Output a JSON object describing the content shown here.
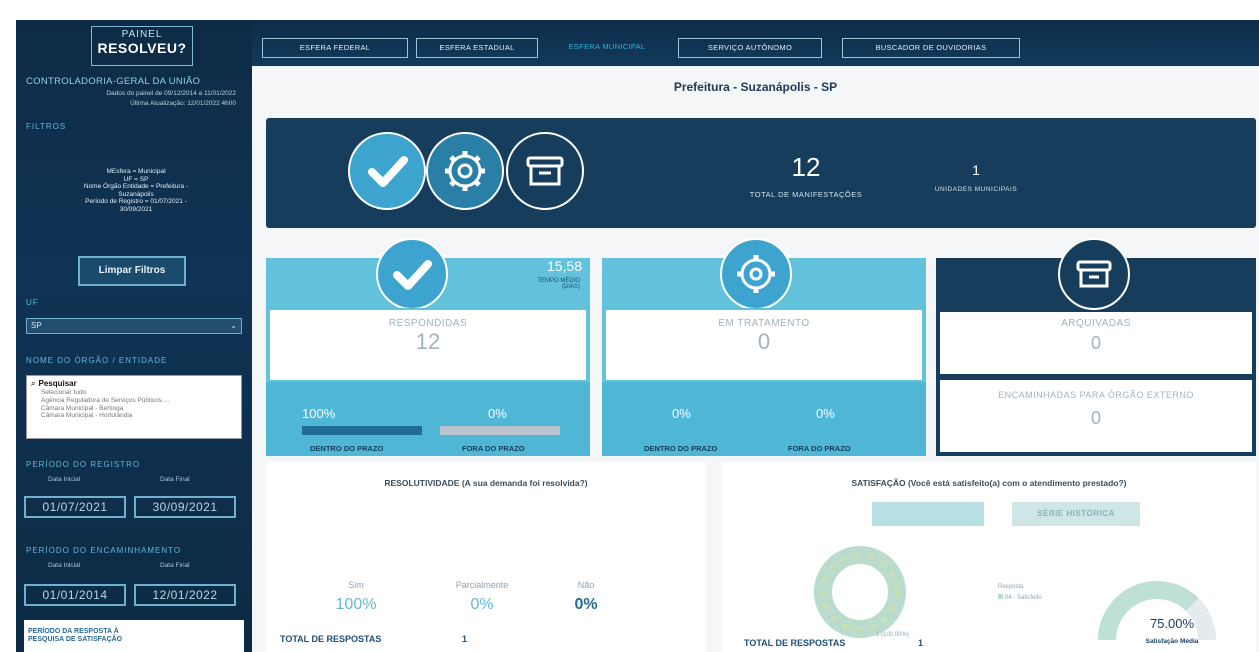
{
  "sidebar": {
    "logo_line1": "PAINEL",
    "logo_line2": "RESOLVEU?",
    "org": "CONTROLADORIA-GERAL DA UNIÃO",
    "data_range": "Dados do painel de 09/12/2014 a 11/01/2022",
    "last_update": "Última Atualização: 12/01/2022 4h00",
    "filters_title": "FILTROS",
    "filters": [
      "MEsfera = Municipal",
      "UF = SP",
      "Nome Órgão Entidade = Prefeitura -",
      "Suzanápolis",
      "Período de Registro = 01/07/2021 -",
      "30/09/2021"
    ],
    "clear_button": "Limpar Filtros",
    "uf_label": "UF",
    "uf_value": "SP",
    "org_label": "NOME DO ÓRGÃO / ENTIDADE",
    "org_search": "Pesquisar",
    "org_items": [
      "Selecionar tudo",
      "Agência Reguladora de Serviços Públicos ...",
      "Câmara Municipal - Bertioga",
      "Câmara Municipal - Hortolândia"
    ],
    "registro_label": "PERÍODO DO REGISTRO",
    "registro_initial_label": "Data Inicial",
    "registro_final_label": "Data Final",
    "registro_initial": "01/07/2021",
    "registro_final": "30/09/2021",
    "encaminhamento_label": "PERÍODO DO ENCAMINHAMENTO",
    "enc_initial_label": "Data Inicial",
    "enc_final_label": "Data Final",
    "enc_initial": "01/01/2014",
    "enc_final": "12/01/2022",
    "resposta_line1": "PERÍODO DA RESPOSTA À",
    "resposta_line2": "PESQUISA DE SATISFAÇÃO"
  },
  "tabs": [
    {
      "label": "ESFERA FEDERAL"
    },
    {
      "label": "ESFERA ESTADUAL"
    },
    {
      "label": "ESFERA MUNICIPAL"
    },
    {
      "label": "SERVIÇO AUTÔNOMO"
    },
    {
      "label": "BUSCADOR DE OUVIDORIAS"
    }
  ],
  "title": "Prefeitura - Suzanápolis - SP",
  "summary": {
    "total_value": "12",
    "total_label": "TOTAL DE MANIFESTAÇÕES",
    "units_value": "1",
    "units_label": "UNIDADES MUNICIPAIS"
  },
  "respondidas": {
    "avg_time": "15,58",
    "avg_time_label1": "TEMPO MÉDIO",
    "avg_time_label2": "(DIAS)",
    "label": "RESPONDIDAS",
    "value": "12",
    "in_time_pct": "100%",
    "out_time_pct": "0%",
    "in_time_fraction": 1.0,
    "in_time_label": "DENTRO DO PRAZO",
    "out_time_label": "FORA DO PRAZO"
  },
  "tratamento": {
    "label": "EM TRATAMENTO",
    "value": "0",
    "in_time_pct": "0%",
    "out_time_pct": "0%",
    "in_time_label": "DENTRO DO PRAZO",
    "out_time_label": "FORA DO PRAZO"
  },
  "arquivadas": {
    "label": "ARQUIVADAS",
    "value": "0",
    "forwarded_label": "ENCAMINHADAS PARA ÓRGÃO EXTERNO",
    "forwarded_value": "0"
  },
  "resolutividade": {
    "title": "RESOLUTIVIDADE (A sua demanda foi resolvida?)",
    "sim_label": "Sim",
    "sim_value": "100%",
    "parcial_label": "Parcialmente",
    "parcial_value": "0%",
    "nao_label": "Não",
    "nao_value": "0%",
    "total_label": "TOTAL DE RESPOSTAS",
    "total_value": "1"
  },
  "satisfacao": {
    "title": "SATISFAÇÃO (Você está satisfeito(a) com o atendimento prestado?)",
    "history_button": "SÉRIE HISTÓRICA",
    "legend_title": "Resposta",
    "legend_item": "04 - Satisfeito",
    "donut_label": "1 (100,00%)",
    "gauge_value": "75.00%",
    "gauge_fraction": 0.75,
    "gauge_label": "Satisfação Média",
    "total_label": "TOTAL DE RESPOSTAS",
    "total_value": "1"
  },
  "colors": {
    "navy": "#163e5c",
    "teal": "#62c2dc",
    "accent": "#2fb3d9",
    "bar_in": "#1f6d96",
    "bar_out": "#b9c4cf"
  }
}
